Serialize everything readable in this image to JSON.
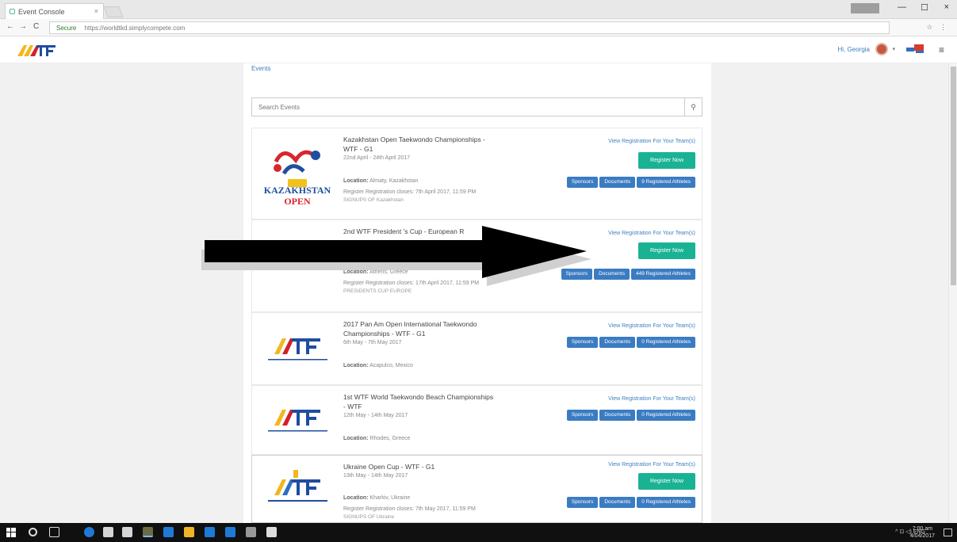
{
  "browser": {
    "tab_title": "Event Console",
    "tab_close": "×",
    "win_minimize": "—",
    "win_maximize": "☐",
    "win_close": "×",
    "back": "←",
    "forward": "→",
    "reload": "C",
    "secure_label": "Secure",
    "url": "https://worldtkd.simplycompete.com",
    "toolbar_icons": "☆ ⋮"
  },
  "header": {
    "user_greeting": "Hi, Georgia",
    "avatar_caret": "▾",
    "menu": "≡"
  },
  "main": {
    "section_title": "Events",
    "search_placeholder": "Search Events",
    "search_icon": "⚲",
    "events": [
      {
        "title": "Kazakhstan Open Taekwondo Championships - WTF - G1",
        "dates": "22nd April - 24th April 2017",
        "location_label": "Location:",
        "location": "Almaty, Kazakhstan",
        "regclose_label": "Register Registration closes:",
        "regclose": "7th April 2017, 11:59 PM",
        "extra": "SIGNUPS OF Kazakhstan",
        "link": "View Registration For Your Team(s)",
        "register": "Register Now",
        "buttons": [
          "Sponsors",
          "Documents",
          "9 Registered Athletes"
        ]
      },
      {
        "title": "2nd WTF President 's Cup - European R",
        "dates": "",
        "location_label": "Location:",
        "location": "Athens, Greece",
        "regclose_label": "Register Registration closes:",
        "regclose": "17th April 2017, 11:59 PM",
        "extra": "PRESIDENTS CUP EUROPE",
        "link": "View Registration For Your Team(s)",
        "register": "Register Now",
        "buttons": [
          "Sponsors",
          "Documents",
          "449 Registered Athletes"
        ]
      },
      {
        "title": "2017 Pan Am Open International Taekwondo Championships - WTF - G1",
        "dates": "6th May - 7th May 2017",
        "location_label": "Location:",
        "location": "Acapulco, Mexico",
        "link": "View Registration For Your Team(s)",
        "buttons": [
          "Sponsors",
          "Documents",
          "0 Registered Athletes"
        ]
      },
      {
        "title": "1st WTF World Taekwondo Beach Championships - WTF",
        "dates": "12th May - 14th May 2017",
        "location_label": "Location:",
        "location": "Rhodes, Greece",
        "link": "View Registration For Your Team(s)",
        "buttons": [
          "Sponsors",
          "Documents",
          "0 Registered Athletes"
        ]
      },
      {
        "title": "Ukraine Open Cup - WTF - G1",
        "dates": "13th May - 14th May 2017",
        "location_label": "Location:",
        "location": "Kharkiv, Ukraine",
        "regclose_label": "Register Registration closes:",
        "regclose": "7th May 2017, 11:59 PM",
        "extra": "SIGNUPS OF Ukraine",
        "link": "View Registration For Your Team(s)",
        "register": "Register Now",
        "buttons": [
          "Sponsors",
          "Documents",
          "0 Registered Athletes"
        ]
      }
    ]
  },
  "taskbar": {
    "tray": "^ ⊡ ◁) ENG",
    "time": "7:00 am",
    "date": "4/04/2017"
  },
  "colors": {
    "register_button": "#19b394",
    "small_button": "#3a7cc2",
    "link": "#3c7fc0",
    "taskbar": "#101010"
  }
}
